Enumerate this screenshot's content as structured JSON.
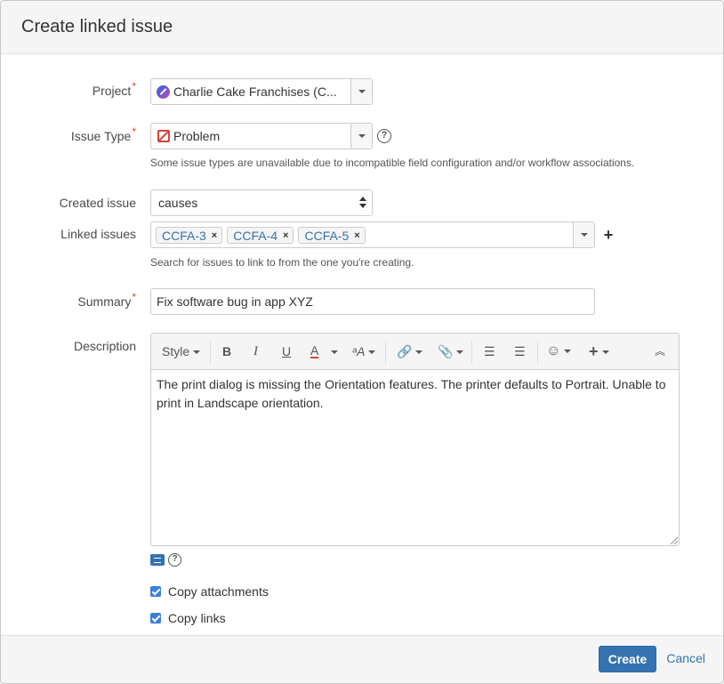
{
  "dialog": {
    "title": "Create linked issue"
  },
  "form": {
    "project": {
      "label": "Project",
      "required_mark": "*",
      "value": "Charlie Cake Franchises (C...",
      "icon": "project-avatar-icon"
    },
    "issue_type": {
      "label": "Issue Type",
      "required_mark": "*",
      "value": "Problem",
      "icon": "problem-icon",
      "help": "?",
      "note": "Some issue types are unavailable due to incompatible field configuration and/or workflow associations."
    },
    "created_issue": {
      "label": "Created issue",
      "value": "causes"
    },
    "linked_issues": {
      "label": "Linked issues",
      "items": [
        {
          "key": "CCFA-3",
          "remove": "×"
        },
        {
          "key": "CCFA-4",
          "remove": "×"
        },
        {
          "key": "CCFA-5",
          "remove": "×"
        }
      ],
      "add": "+",
      "note": "Search for issues to link to from the one you're creating."
    },
    "summary": {
      "label": "Summary",
      "required_mark": "*",
      "value": "Fix software bug in app XYZ"
    },
    "description": {
      "label": "Description",
      "toolbar": {
        "style": "Style",
        "bold": "B",
        "italic": "I",
        "underline": "U",
        "text_color": "A",
        "text_effects": "ᵃA",
        "link": "🔗",
        "attachment": "📎",
        "bullet_list": "☰",
        "numbered_list": "☰",
        "emoticon": "☺",
        "insert": "+",
        "collapse": "︽"
      },
      "value": "The print dialog is missing the Orientation features. The printer defaults to Portrait. Unable to print in Landscape orientation.",
      "help": "?"
    },
    "copy_attachments": {
      "label": "Copy attachments",
      "checked": true
    },
    "copy_links": {
      "label": "Copy links",
      "checked": true
    }
  },
  "footer": {
    "create": "Create",
    "cancel": "Cancel"
  },
  "colors": {
    "primary": "#3572b0",
    "required": "#d04437",
    "checkbox": "#3b7fd9"
  }
}
